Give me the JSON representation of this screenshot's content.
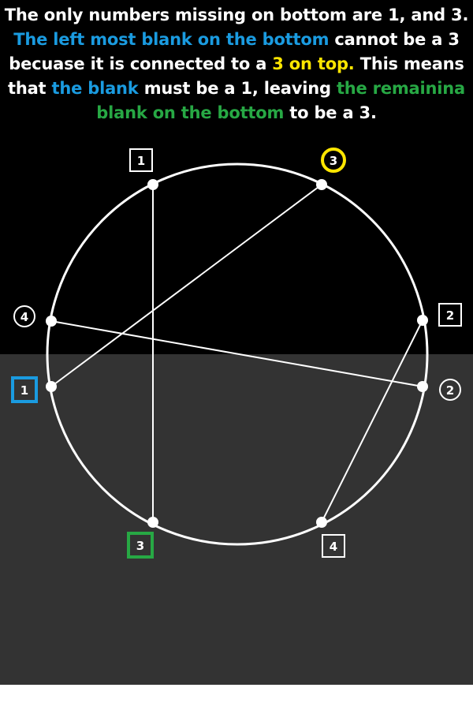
{
  "caption": {
    "segments": [
      {
        "text": "The only numbers missing on bottom are 1, and 3. ",
        "color": "white"
      },
      {
        "text": "The left most blank on the bottom",
        "color": "blue"
      },
      {
        "text": " cannot be a 3 becuase it is connected to a ",
        "color": "white"
      },
      {
        "text": "3 on top.",
        "color": "yellow"
      },
      {
        "text": " This means that ",
        "color": "white"
      },
      {
        "text": "the blank",
        "color": "blue"
      },
      {
        "text": " must be a 1, leaving ",
        "color": "white"
      },
      {
        "text": "the remainina blank on the bottom",
        "color": "green"
      },
      {
        "text": " to be a 3.",
        "color": "white"
      }
    ]
  },
  "colors": {
    "top_background": "#000000",
    "bottom_background": "#333333",
    "blue": "#1a9be0",
    "yellow": "#ffe600",
    "green": "#27a844",
    "white": "#ffffff"
  },
  "diagram": {
    "labels": [
      {
        "id": "top-left",
        "text": "1",
        "shape": "square",
        "color": "white"
      },
      {
        "id": "top-right",
        "text": "3",
        "shape": "circle",
        "color": "yellow"
      },
      {
        "id": "left-upper",
        "text": "4",
        "shape": "circle",
        "color": "white"
      },
      {
        "id": "right-upper",
        "text": "2",
        "shape": "square",
        "color": "white"
      },
      {
        "id": "left-lower",
        "text": "1",
        "shape": "square",
        "color": "blue"
      },
      {
        "id": "right-lower",
        "text": "2",
        "shape": "circle",
        "color": "white"
      },
      {
        "id": "bottom-left",
        "text": "3",
        "shape": "square",
        "color": "green"
      },
      {
        "id": "bottom-right",
        "text": "4",
        "shape": "square",
        "color": "white"
      }
    ],
    "connections": [
      [
        "top-left",
        "bottom-left"
      ],
      [
        "top-right",
        "left-lower"
      ],
      [
        "left-upper",
        "right-lower"
      ],
      [
        "right-upper",
        "bottom-right"
      ]
    ]
  }
}
